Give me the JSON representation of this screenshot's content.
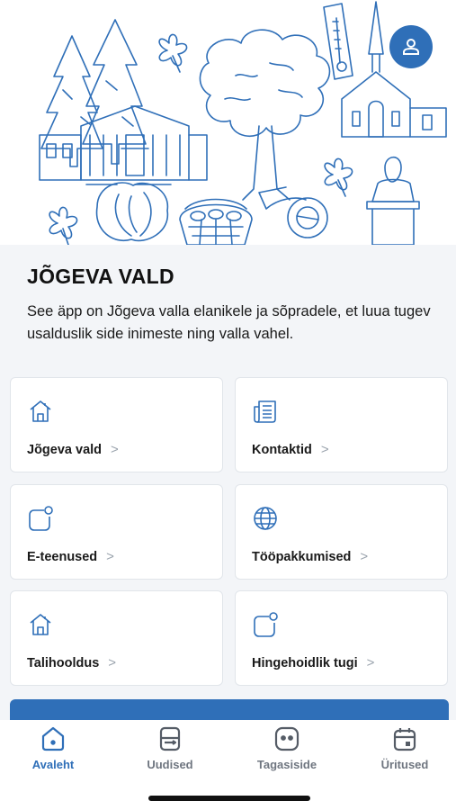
{
  "colors": {
    "accent": "#2f6fb8",
    "background": "#f3f5f8",
    "card": "#ffffff",
    "inactive_tab": "#6f7680"
  },
  "header": {
    "profile_icon": "user-icon"
  },
  "main": {
    "title": "JÕGEVA VALD",
    "description": "See äpp on Jõgeva valla elanikele ja sõpradele, et luua tugev usalduslik side inimeste ning valla vahel.",
    "cards": [
      {
        "label": "Jõgeva vald",
        "icon": "house-icon"
      },
      {
        "label": "Kontaktid",
        "icon": "newspaper-icon"
      },
      {
        "label": "E-teenused",
        "icon": "square-dot-icon"
      },
      {
        "label": "Tööpakkumised",
        "icon": "globe-icon"
      },
      {
        "label": "Talihooldus",
        "icon": "house-icon"
      },
      {
        "label": "Hingehoidlik tugi",
        "icon": "square-dot-icon"
      }
    ]
  },
  "tabbar": {
    "tabs": [
      {
        "label": "Avaleht",
        "icon": "home-icon",
        "active": true
      },
      {
        "label": "Uudised",
        "icon": "news-icon",
        "active": false
      },
      {
        "label": "Tagasiside",
        "icon": "feedback-icon",
        "active": false
      },
      {
        "label": "Üritused",
        "icon": "calendar-icon",
        "active": false
      }
    ]
  }
}
